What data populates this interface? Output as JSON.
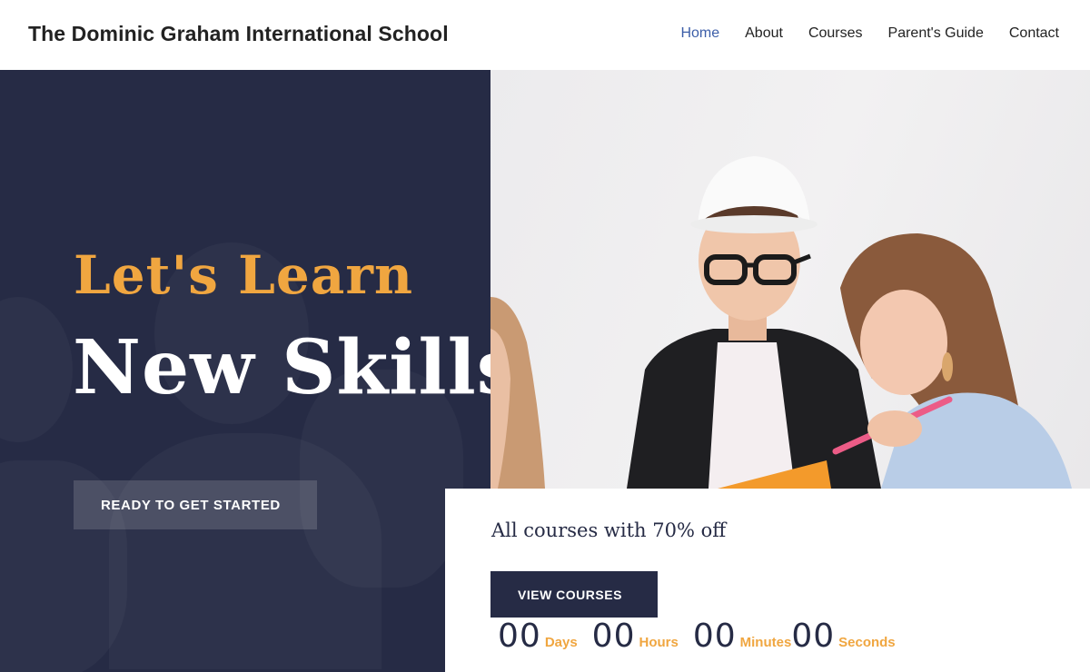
{
  "header": {
    "brand": "The Dominic Graham International School",
    "nav": [
      {
        "label": "Home",
        "active": true
      },
      {
        "label": "About",
        "active": false
      },
      {
        "label": "Courses",
        "active": false
      },
      {
        "label": "Parent's Guide",
        "active": false
      },
      {
        "label": "Contact",
        "active": false
      }
    ]
  },
  "hero": {
    "headline_top": "Let's Learn",
    "headline_main": "New Skills",
    "cta_label": "READY TO GET STARTED"
  },
  "offer": {
    "text": "All courses with 70% off",
    "cta_label": "VIEW COURSES",
    "countdown": [
      {
        "value": "00",
        "label": "Days"
      },
      {
        "value": "00",
        "label": "Hours"
      },
      {
        "value": "00",
        "label": "Minutes"
      },
      {
        "value": "00",
        "label": "Seconds"
      }
    ]
  },
  "colors": {
    "navy": "#262b45",
    "accent": "#f0a640",
    "nav_active": "#3c5ea8"
  }
}
